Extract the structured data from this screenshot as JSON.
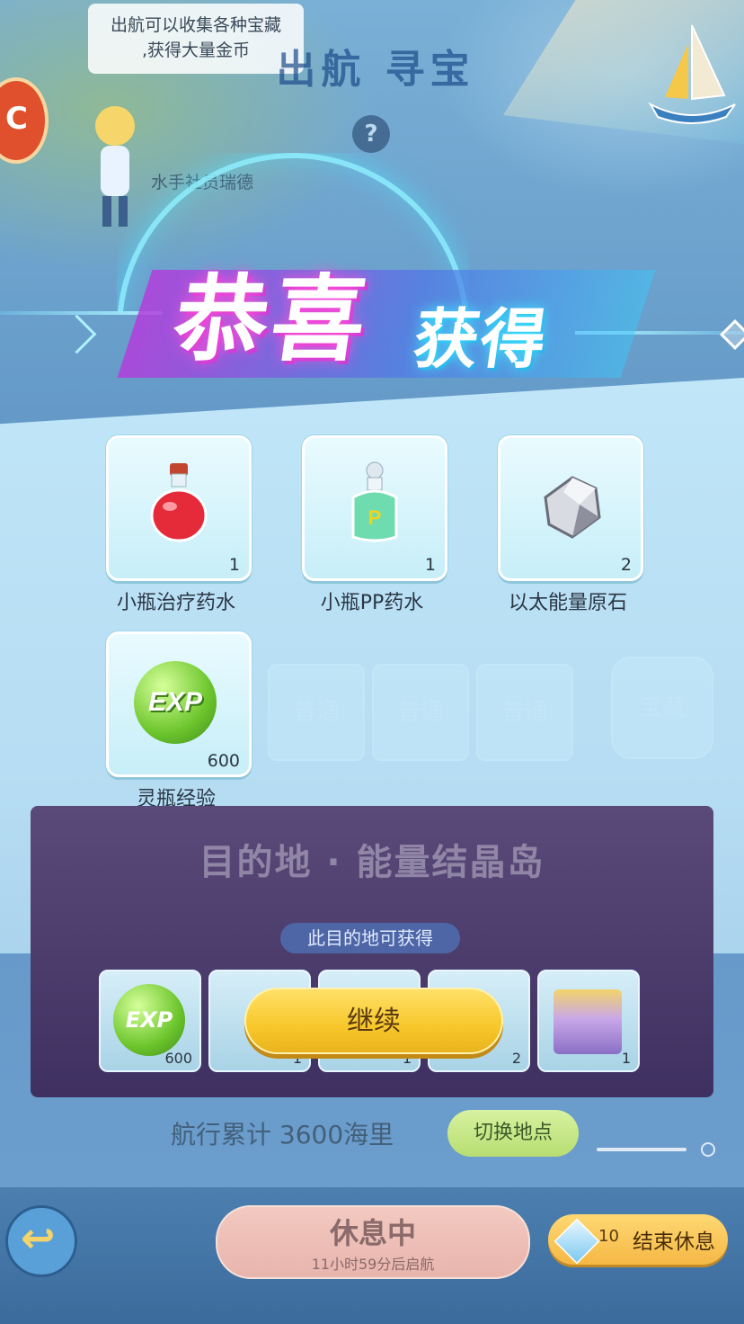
{
  "scene": {
    "tip_line1": "出航可以收集各种宝藏",
    "tip_line2": ",获得大量金币",
    "banner_title": "出航 寻宝",
    "help_icon": "?",
    "npc_name": "水手社员瑞德"
  },
  "dialog": {
    "title_main": "恭喜",
    "title_sub": "获得",
    "items": [
      {
        "name": "小瓶治疗药水",
        "count": "1",
        "icon": "red-potion-icon"
      },
      {
        "name": "小瓶PP药水",
        "count": "1",
        "icon": "pp-potion-icon"
      },
      {
        "name": "以太能量原石",
        "count": "2",
        "icon": "ether-ore-icon"
      },
      {
        "name": "灵瓶经验",
        "count": "600",
        "icon": "exp-orb-icon",
        "exp_text": "EXP"
      }
    ],
    "continue_label": "继续"
  },
  "background_ui": {
    "tiles": [
      "普通",
      "普通",
      "普通",
      "宝藏"
    ],
    "destination_title": "目的地 · 能量结晶岛",
    "destination_subtitle": "此目的地可获得",
    "reward_tiles": [
      {
        "label": "EXP",
        "count": "600"
      },
      {
        "count": "1"
      },
      {
        "count": "1"
      },
      {
        "count": "2"
      },
      {
        "count": "1"
      }
    ],
    "mileage": "航行累计 3600海里",
    "switch_label": "切换地点",
    "rest_title": "休息中",
    "rest_subtitle": "11小时59分后启航",
    "end_rest_count": "10",
    "end_rest_label": "结束休息"
  },
  "colors": {
    "accent_yellow": "#f7c72a",
    "title_pink": "#ff4fd8",
    "title_cyan": "#3ee6ff",
    "panel_bg": "#cdf0ff"
  }
}
